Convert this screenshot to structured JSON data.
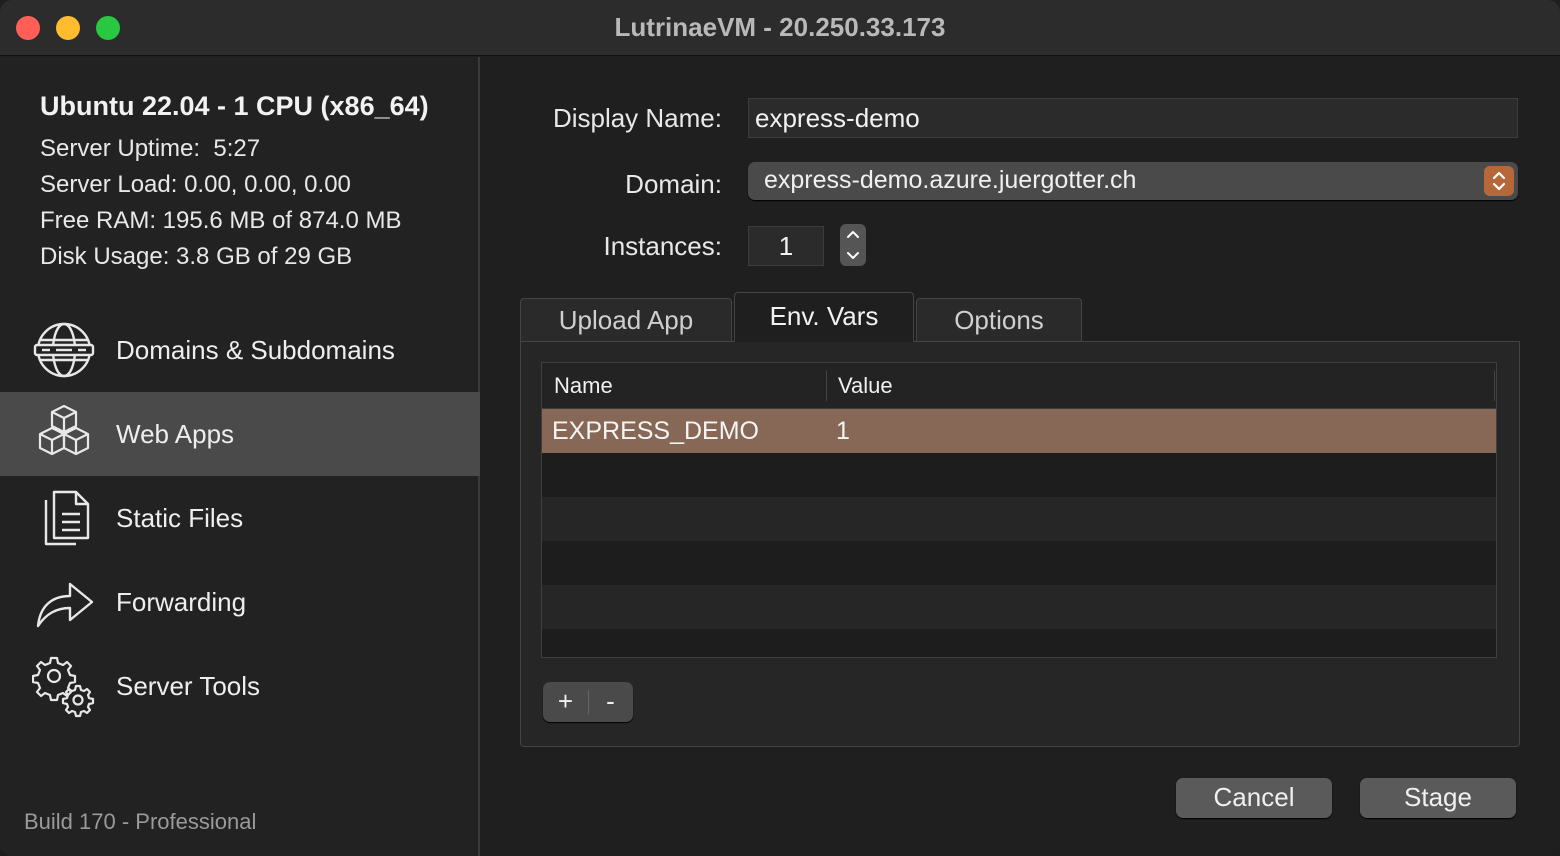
{
  "window": {
    "title": "LutrinaeVM - 20.250.33.173"
  },
  "sidebar": {
    "system_title": "Ubuntu 22.04 - 1 CPU (x86_64)",
    "uptime": "Server Uptime:  5:27",
    "load": "Server Load: 0.00, 0.00, 0.00",
    "ram": "Free RAM: 195.6 MB of 874.0 MB",
    "disk": "Disk Usage: 3.8 GB of 29 GB",
    "items": [
      {
        "label": "Domains & Subdomains",
        "icon": "globe-icon",
        "selected": false
      },
      {
        "label": "Web Apps",
        "icon": "cubes-icon",
        "selected": true
      },
      {
        "label": "Static Files",
        "icon": "documents-icon",
        "selected": false
      },
      {
        "label": "Forwarding",
        "icon": "forward-arrow-icon",
        "selected": false
      },
      {
        "label": "Server Tools",
        "icon": "gears-icon",
        "selected": false
      }
    ],
    "build": "Build 170 - Professional"
  },
  "form": {
    "display_name_label": "Display Name:",
    "display_name_value": "express-demo",
    "domain_label": "Domain:",
    "domain_value": "express-demo.azure.juergotter.ch",
    "instances_label": "Instances:",
    "instances_value": "1"
  },
  "tabs": [
    {
      "label": "Upload App",
      "active": false
    },
    {
      "label": "Env. Vars",
      "active": true
    },
    {
      "label": "Options",
      "active": false
    }
  ],
  "env_table": {
    "columns": [
      "Name",
      "Value"
    ],
    "rows": [
      {
        "name": "EXPRESS_DEMO",
        "value": "1",
        "selected": true
      }
    ]
  },
  "table_buttons": {
    "add": "+",
    "remove": "-"
  },
  "actions": {
    "cancel": "Cancel",
    "stage": "Stage"
  },
  "colors": {
    "accent": "#b7683a",
    "selection": "#876856"
  }
}
